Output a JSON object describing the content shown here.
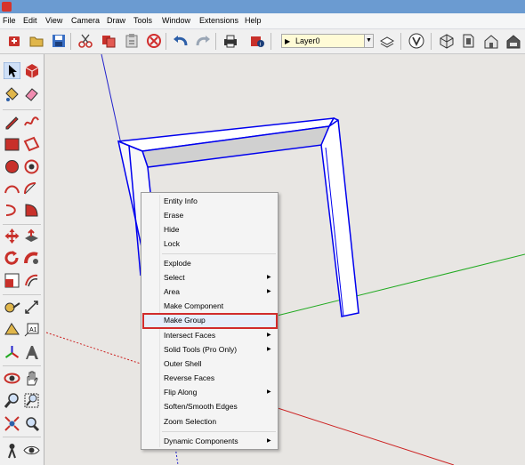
{
  "menubar": {
    "items": [
      {
        "label": "File"
      },
      {
        "label": "Edit"
      },
      {
        "label": "View"
      },
      {
        "label": "Camera"
      },
      {
        "label": "Draw"
      },
      {
        "label": "Tools"
      },
      {
        "label": "Window"
      },
      {
        "label": "Extensions"
      },
      {
        "label": "Help"
      }
    ]
  },
  "toolbar": {
    "layer_selector": {
      "value": "Layer0"
    }
  },
  "context_menu": {
    "items": [
      {
        "label": "Entity Info",
        "has_submenu": false
      },
      {
        "label": "Erase",
        "has_submenu": false
      },
      {
        "label": "Hide",
        "has_submenu": false
      },
      {
        "label": "Lock",
        "has_submenu": false
      },
      {
        "label": "Explode",
        "has_submenu": false
      },
      {
        "label": "Select",
        "has_submenu": true
      },
      {
        "label": "Area",
        "has_submenu": true
      },
      {
        "label": "Make Component",
        "has_submenu": false
      },
      {
        "label": "Make Group",
        "has_submenu": false,
        "highlighted": true
      },
      {
        "label": "Intersect Faces",
        "has_submenu": true
      },
      {
        "label": "Solid Tools (Pro Only)",
        "has_submenu": true
      },
      {
        "label": "Outer Shell",
        "has_submenu": false
      },
      {
        "label": "Reverse Faces",
        "has_submenu": false
      },
      {
        "label": "Flip Along",
        "has_submenu": true
      },
      {
        "label": "Soften/Smooth Edges",
        "has_submenu": false
      },
      {
        "label": "Zoom Selection",
        "has_submenu": false
      },
      {
        "label": "Dynamic Components",
        "has_submenu": true
      }
    ]
  },
  "colors": {
    "title_bar": "#6b9bd1",
    "highlight_border": "#d12c2c",
    "selection_edge": "#0000ee",
    "axis_red": "#cc2222",
    "axis_green": "#22aa22",
    "axis_blue": "#2222cc"
  }
}
